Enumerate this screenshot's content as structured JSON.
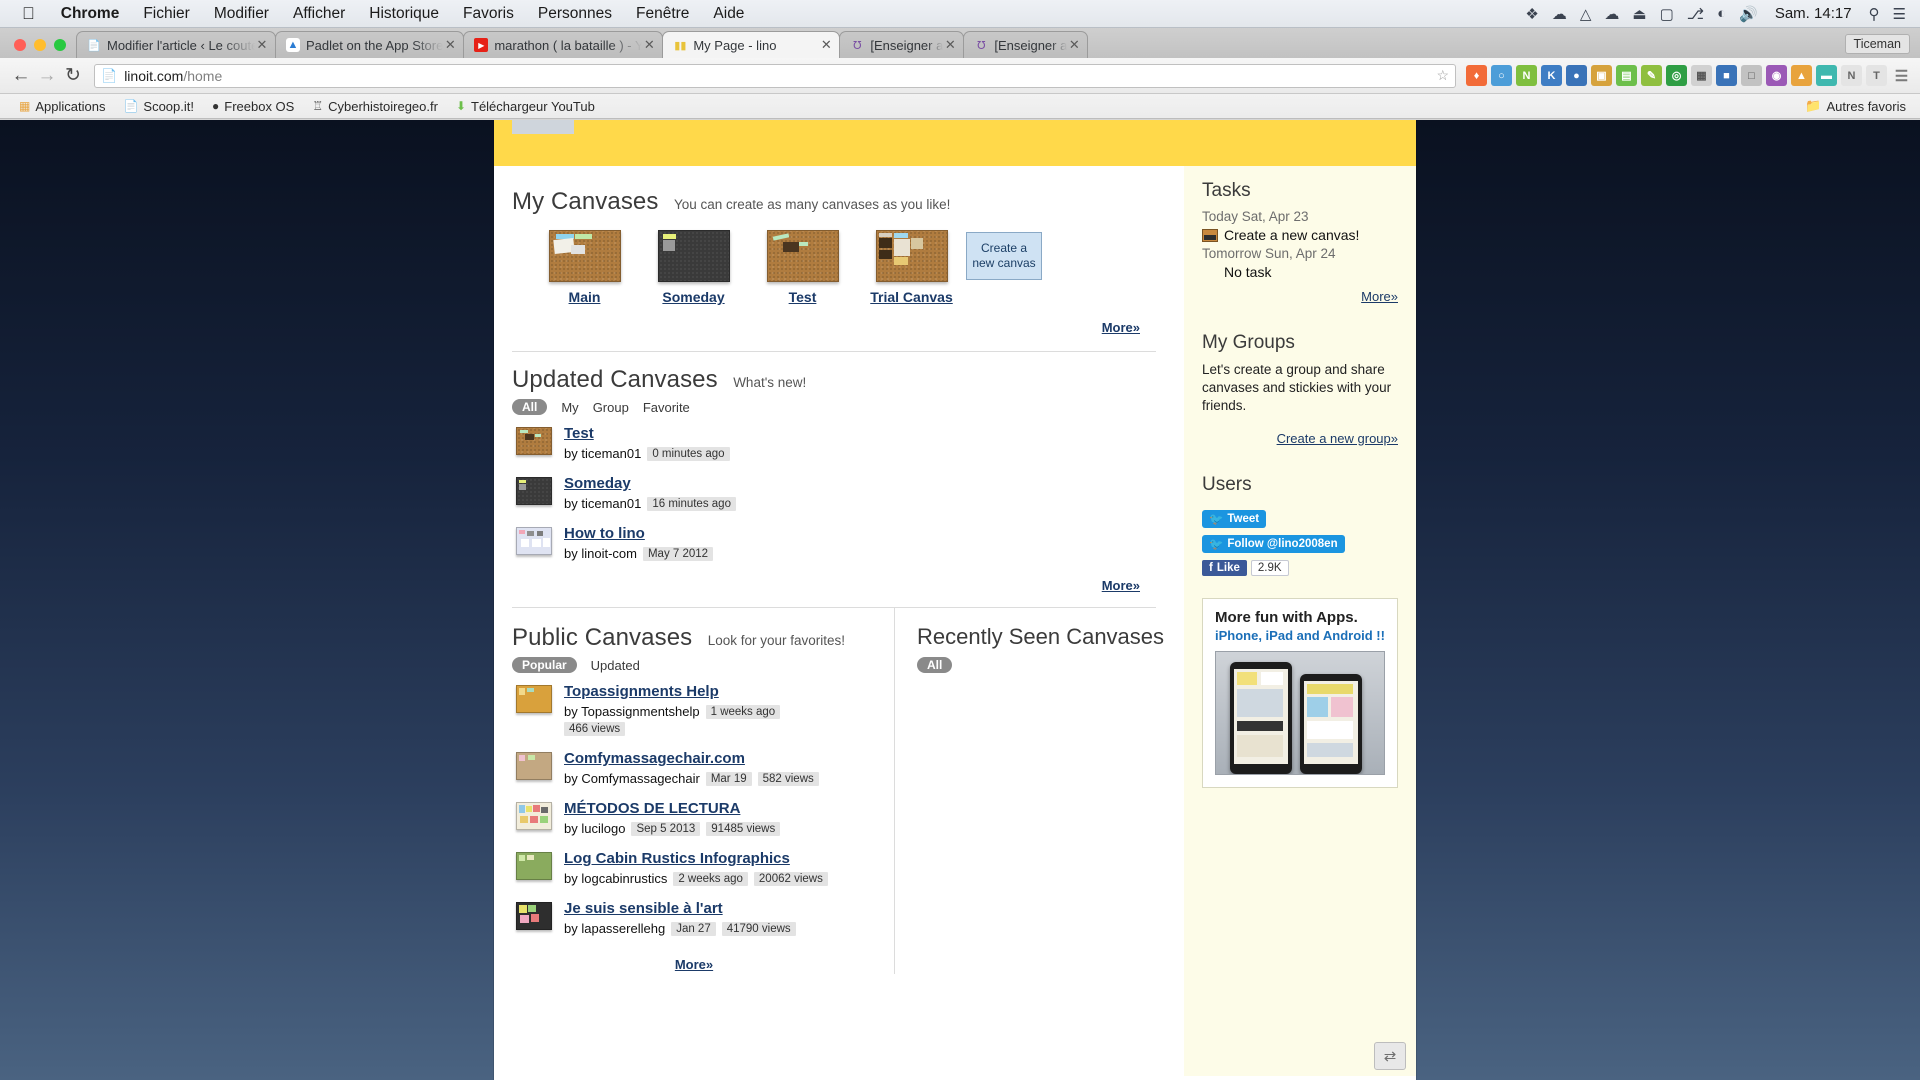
{
  "macbar": {
    "apple_icon": "apple-logo",
    "items": [
      {
        "label": "Chrome",
        "bold": true
      },
      {
        "label": "Fichier",
        "bold": false
      },
      {
        "label": "Modifier",
        "bold": false
      },
      {
        "label": "Afficher",
        "bold": false
      },
      {
        "label": "Historique",
        "bold": false
      },
      {
        "label": "Favoris",
        "bold": false
      },
      {
        "label": "Personnes",
        "bold": false
      },
      {
        "label": "Fenêtre",
        "bold": false
      },
      {
        "label": "Aide",
        "bold": false
      }
    ],
    "status_icons": [
      "dropbox-icon",
      "cloud-icon",
      "google-drive-icon",
      "onedrive-icon",
      "eject-icon",
      "airplay-icon",
      "bluetooth-icon",
      "wifi-icon",
      "volume-icon"
    ],
    "clock": "Sam. 14:17",
    "search_icon": "search-icon",
    "menu_icon": "control-center-icon"
  },
  "chrome": {
    "window_user": "Ticeman",
    "tabs": [
      {
        "title": "Modifier l'article ‹ Le coute",
        "favicon": "page-icon",
        "active": false
      },
      {
        "title": "Padlet on the App Store",
        "favicon": "appstore-icon",
        "active": false
      },
      {
        "title": "marathon ( la bataille ) - Yo",
        "favicon": "youtube-icon",
        "active": false
      },
      {
        "title": "My Page - lino",
        "favicon": "lino-icon",
        "active": true
      },
      {
        "title": "[Enseigner avec le numéri",
        "favicon": "site-icon",
        "active": false
      },
      {
        "title": "[Enseigner avec le numéri",
        "favicon": "site-icon",
        "active": false
      }
    ],
    "back_icon": "back-arrow-icon",
    "forward_icon": "forward-arrow-icon",
    "reload_icon": "reload-icon",
    "url_host": "linoit.com",
    "url_path": "/home",
    "url_full": "linoit.com/home",
    "page_icon": "document-icon",
    "star_icon": "star-icon",
    "extensions": [
      {
        "name": "flame-extension-icon",
        "glyph": "◆",
        "color": "#f26b38"
      },
      {
        "name": "clock-extension-icon",
        "glyph": "○",
        "color": "#4c9dd8"
      },
      {
        "name": "evernote-extension-icon",
        "glyph": "N",
        "color": "#7fbf3f"
      },
      {
        "name": "kobo-extension-icon",
        "glyph": "K",
        "color": "#3e7dc4"
      },
      {
        "name": "diigo-extension-icon",
        "glyph": "●",
        "color": "#3a73b8"
      },
      {
        "name": "image-extension-icon",
        "glyph": "▣",
        "color": "#d6a23c"
      },
      {
        "name": "cart-extension-icon",
        "glyph": "▤",
        "color": "#6dbf4b"
      },
      {
        "name": "pen-extension-icon",
        "glyph": "✐",
        "color": "#8fbf3f"
      },
      {
        "name": "globe-extension-icon",
        "glyph": "◎",
        "color": "#2f9e44"
      },
      {
        "name": "grid-extension-icon",
        "glyph": "▦",
        "color": "#d1d1d1"
      },
      {
        "name": "blue-extension-icon",
        "glyph": "■",
        "color": "#3a73b8"
      },
      {
        "name": "camera-extension-icon",
        "glyph": "□",
        "color": "#c2c2c2"
      },
      {
        "name": "purple-extension-icon",
        "glyph": "◉",
        "color": "#9b59b6"
      },
      {
        "name": "orange-extension-icon",
        "glyph": "▲",
        "color": "#e8a33d"
      },
      {
        "name": "teal-extension-icon",
        "glyph": "▬",
        "color": "#3fb8af"
      },
      {
        "name": "n-extension-icon",
        "glyph": "N",
        "color": "#e4e4e4"
      },
      {
        "name": "t-extension-icon",
        "glyph": "T",
        "color": "#e4e4e4"
      },
      {
        "name": "menu-icon",
        "glyph": "☰",
        "color": "#8a8a8a"
      }
    ],
    "bookmarks": [
      {
        "label": "Applications",
        "icon": "apps-grid-icon"
      },
      {
        "label": "Scoop.it!",
        "icon": "page-icon"
      },
      {
        "label": "Freebox OS",
        "icon": "freebox-icon"
      },
      {
        "label": "Cyberhistoiregeo.fr",
        "icon": "owl-icon"
      },
      {
        "label": "Téléchargeur YouTub",
        "icon": "download-icon"
      }
    ],
    "bookmarks_overflow": "Autres favoris",
    "bookmarks_overflow_icon": "folder-icon"
  },
  "page": {
    "my_canvases": {
      "title": "My Canvases",
      "subtitle": "You can create as many canvases as you like!",
      "items": [
        {
          "name": "Main",
          "style": "cork"
        },
        {
          "name": "Someday",
          "style": "dark"
        },
        {
          "name": "Test",
          "style": "cork"
        },
        {
          "name": "Trial Canvas",
          "style": "cork"
        }
      ],
      "create_label": "Create a new canvas",
      "more_label": "More»"
    },
    "updated_canvases": {
      "title": "Updated Canvases",
      "subtitle": "What's new!",
      "filters": [
        "All",
        "My",
        "Group",
        "Favorite"
      ],
      "active_filter": "All",
      "items": [
        {
          "title": "Test",
          "by": "by ticeman01",
          "time": "0 minutes ago",
          "style": "cork"
        },
        {
          "title": "Someday",
          "by": "by ticeman01",
          "time": "16 minutes ago",
          "style": "dark"
        },
        {
          "title": "How to lino",
          "by": "by linoit-com",
          "time": "May 7 2012",
          "style": "light"
        }
      ],
      "more_label": "More»"
    },
    "public_canvases": {
      "title": "Public Canvases",
      "subtitle": "Look for your favorites!",
      "filters": [
        "Popular",
        "Updated"
      ],
      "active_filter": "Popular",
      "items": [
        {
          "title": "Topassignments Help",
          "by": "by Topassignmentshelp",
          "time": "1 weeks ago",
          "views": "466 views",
          "style": "gold"
        },
        {
          "title": "Comfymassagechair.com",
          "by": "by Comfymassagechair",
          "time": "Mar 19",
          "views": "582 views",
          "style": "tan"
        },
        {
          "title": "MÉTODOS DE LECTURA",
          "by": "by lucilogo",
          "time": "Sep 5 2013",
          "views": "91485 views",
          "style": "cream"
        },
        {
          "title": "Log Cabin Rustics Infographics",
          "by": "by logcabinrustics",
          "time": "2 weeks ago",
          "views": "20062 views",
          "style": "green"
        },
        {
          "title": "Je suis sensible à l'art",
          "by": "by lapasserellehg",
          "time": "Jan 27",
          "views": "41790 views",
          "style": "darkart"
        }
      ],
      "more_label": "More»"
    },
    "recently_seen": {
      "title": "Recently Seen Canvases",
      "filters": [
        "All"
      ],
      "active_filter": "All"
    },
    "sidebar": {
      "tasks": {
        "title": "Tasks",
        "today_label": "Today Sat, Apr 23",
        "today_task": "Create a new canvas!",
        "tomorrow_label": "Tomorrow Sun, Apr 24",
        "tomorrow_task": "No task",
        "more_label": "More»"
      },
      "groups": {
        "title": "My Groups",
        "description": "Let's create a group and share canvases and stickies with your friends.",
        "create_label": "Create a new group»"
      },
      "users": {
        "title": "Users"
      },
      "social": {
        "tweet_label": "Tweet",
        "tweet_icon": "twitter-bird-icon",
        "follow_label": "Follow @lino2008en",
        "follow_icon": "twitter-bird-icon",
        "like_label": "Like",
        "like_icon": "facebook-f-icon",
        "like_count": "2.9K"
      },
      "apps": {
        "title": "More fun with Apps.",
        "subtitle": "iPhone, iPad and Android !!"
      }
    },
    "float_widget_icon": "arrows-icon"
  }
}
